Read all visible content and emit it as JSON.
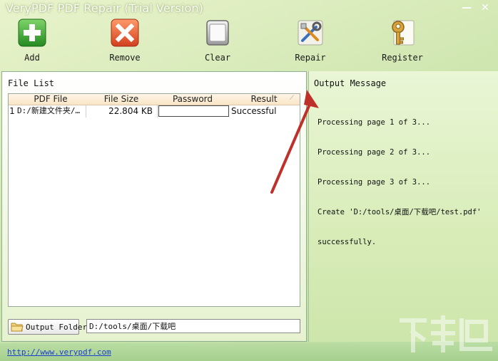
{
  "window": {
    "title": "VeryPDF PDF Repair (Trial Version)",
    "minimize_glyph": "—",
    "close_glyph": "✕"
  },
  "toolbar": {
    "add_label": "Add",
    "remove_label": "Remove",
    "clear_label": "Clear",
    "repair_label": "Repair",
    "register_label": "Register"
  },
  "file_list": {
    "label": "File List",
    "columns": [
      "PDF File",
      "File Size",
      "Password",
      "Result"
    ],
    "rows": [
      {
        "index": "1",
        "file": "D:/新建文件夹/…",
        "size": "22.804 KB",
        "password": "",
        "result": "Successful"
      }
    ]
  },
  "output_folder": {
    "button_label": "Output Folder",
    "path": "D:/tools/桌面/下载吧"
  },
  "output": {
    "title": "Output Message",
    "lines": [
      "Processing page 1 of 3...",
      "Processing page 2 of 3...",
      "Processing page 3 of 3...",
      "Create 'D:/tools/桌面/下载吧/test.pdf'",
      "successfully."
    ]
  },
  "status": {
    "link": "http://www.verypdf.com"
  },
  "colors": {
    "accent_add": "#2e9a2a",
    "accent_remove": "#e0502a",
    "link": "#1a3fd0",
    "arrow": "#c0302a"
  },
  "icons": {
    "add": "plus-icon",
    "remove": "x-icon",
    "clear": "clear-icon",
    "repair": "tools-icon",
    "register": "key-icon",
    "output_folder": "folder-icon"
  }
}
